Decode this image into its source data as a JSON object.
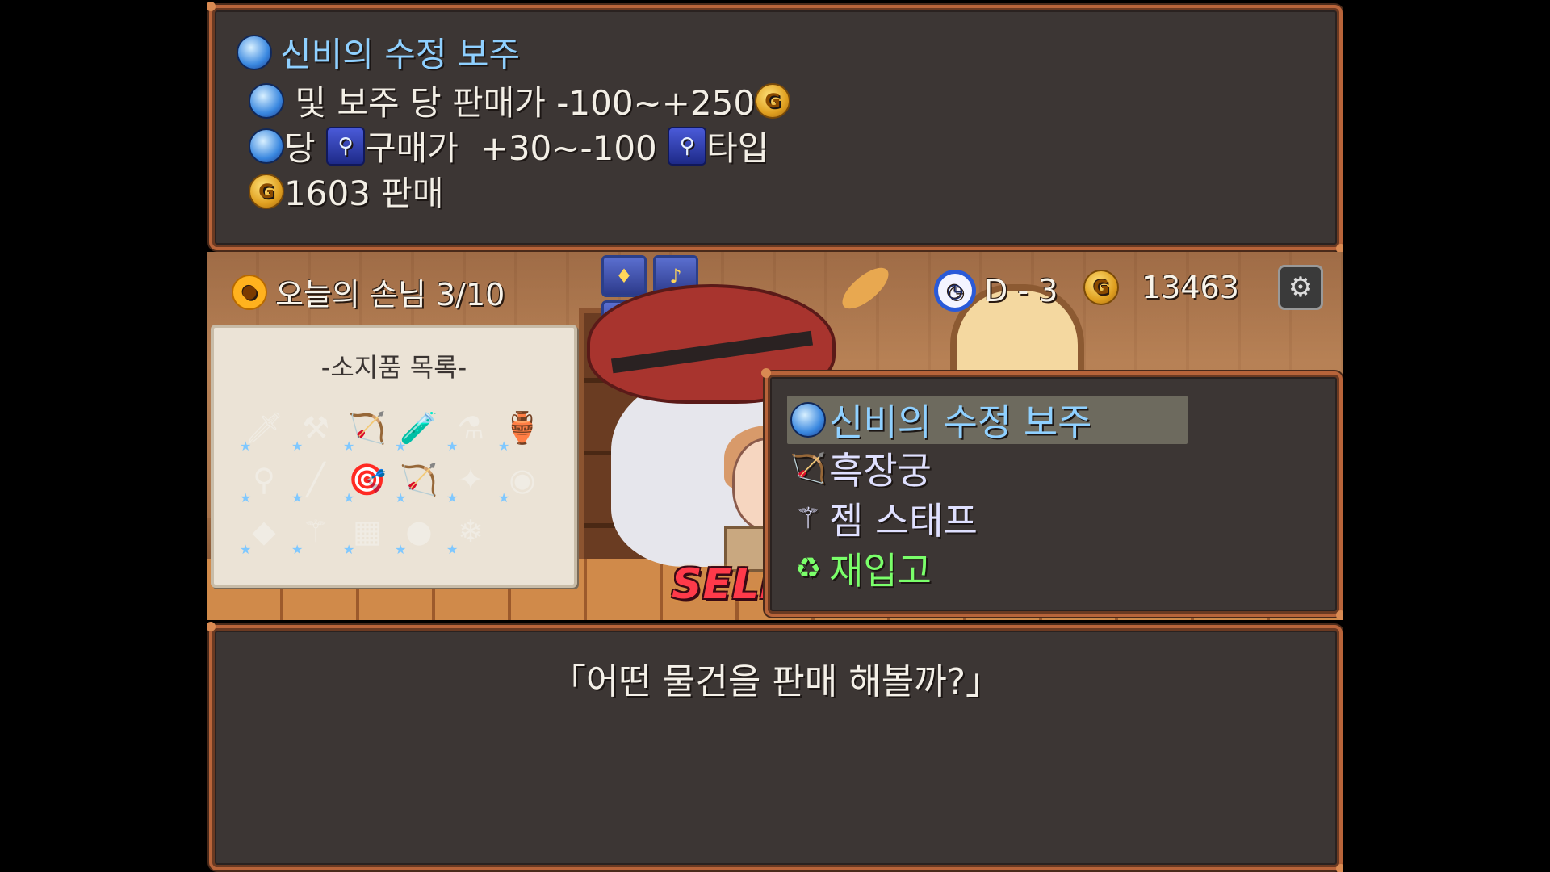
{
  "info": {
    "title": "신비의 수정 보주",
    "line1_text": " 및 보주 당 판매가 -100~+250",
    "line2_a": "당 ",
    "line2_b": "구매가  +30~-100 ",
    "line2_c": "타입",
    "line3_text": "1603 판매"
  },
  "hud": {
    "guests": "오늘의 손님 3/10",
    "day": "D - 3",
    "gold": "13463"
  },
  "inventory": {
    "title": "-소지품 목록-",
    "items": [
      {
        "icon": "sword-icon",
        "glyph": "🗡"
      },
      {
        "icon": "mace-icon",
        "glyph": "⚒"
      },
      {
        "icon": "crossbow-icon",
        "glyph": "🏹"
      },
      {
        "icon": "blue-vial-icon",
        "glyph": "🧪"
      },
      {
        "icon": "red-potion-icon",
        "glyph": "⚗"
      },
      {
        "icon": "green-jar-icon",
        "glyph": "🏺"
      },
      {
        "icon": "wand-icon",
        "glyph": "⚲"
      },
      {
        "icon": "staff-icon",
        "glyph": "╱"
      },
      {
        "icon": "quiver-icon",
        "glyph": "🎯"
      },
      {
        "icon": "black-bow-icon",
        "glyph": "🏹"
      },
      {
        "icon": "scepter-icon",
        "glyph": "✦"
      },
      {
        "icon": "gold-orb-icon",
        "glyph": "◉"
      },
      {
        "icon": "emerald-icon",
        "glyph": "◆"
      },
      {
        "icon": "gem-staff-icon",
        "glyph": "⚚"
      },
      {
        "icon": "iron-plate-icon",
        "glyph": "▦"
      },
      {
        "icon": "crystal-orb-icon",
        "glyph": "●"
      },
      {
        "icon": "ice-crystal-icon",
        "glyph": "❄"
      }
    ]
  },
  "menu": {
    "items": [
      {
        "label": "신비의 수정 보주",
        "icon": "crystal-orb-icon"
      },
      {
        "label": "흑장궁",
        "icon": "black-bow-icon"
      },
      {
        "label": "젬 스태프",
        "icon": "gem-staff-icon"
      },
      {
        "label": "재입고",
        "icon": "restock-icon"
      }
    ],
    "selected_index": 0
  },
  "dialog": {
    "text": "「어떤 물건을 판매 해볼까?」"
  },
  "banner": {
    "text": "SELLTURN"
  },
  "colors": {
    "frame": "#b8643a",
    "panel": "#3c3634",
    "highlight": "#8fd0ff",
    "restock": "#7aff6a",
    "banner": "#ff3a4a"
  }
}
